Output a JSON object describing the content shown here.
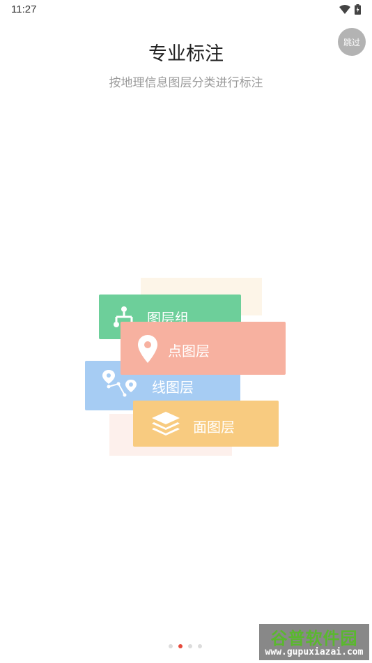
{
  "status_bar": {
    "time": "11:27"
  },
  "skip": {
    "label": "跳过"
  },
  "header": {
    "title": "专业标注",
    "subtitle": "按地理信息图层分类进行标注"
  },
  "layers": [
    {
      "label": "图层组",
      "icon": "hierarchy-icon",
      "color": "#6dcf9a"
    },
    {
      "label": "点图层",
      "icon": "location-pin-icon",
      "color": "#f7b1a0"
    },
    {
      "label": "线图层",
      "icon": "route-icon",
      "color": "#a6ccf3"
    },
    {
      "label": "面图层",
      "icon": "stack-layers-icon",
      "color": "#f8cb80"
    }
  ],
  "pager": {
    "count": 4,
    "active_index": 1
  },
  "watermark": {
    "logo": "谷普软件园",
    "url": "www.gupuxiazai.com"
  }
}
